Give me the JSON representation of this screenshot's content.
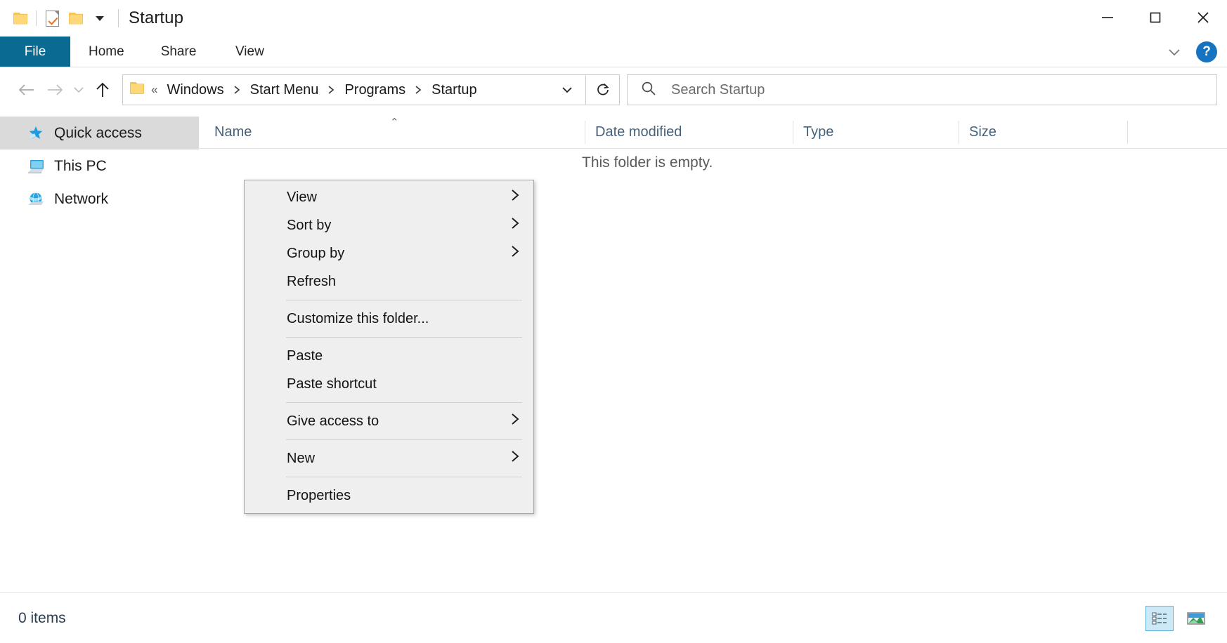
{
  "window": {
    "title": "Startup",
    "controls": {
      "minimize": "minimize-icon",
      "maximize": "maximize-icon",
      "close": "close-icon"
    },
    "quick_access_toolbar": {
      "folder_icon": "folder-icon",
      "properties_icon": "document-checkmark-icon",
      "new_folder_icon": "folder-icon",
      "customize_caret": "caret-down-icon"
    }
  },
  "ribbon": {
    "tabs": [
      {
        "label": "File",
        "active": true
      },
      {
        "label": "Home",
        "active": false
      },
      {
        "label": "Share",
        "active": false
      },
      {
        "label": "View",
        "active": false
      }
    ],
    "expand_icon": "chevron-down-icon",
    "help_label": "?",
    "file_tab_color": "#0b6a91"
  },
  "address": {
    "back_icon": "arrow-left-icon",
    "forward_icon": "arrow-right-icon",
    "recent_icon": "chevron-down-icon",
    "up_icon": "arrow-up-icon",
    "folder_icon": "folder-icon",
    "overflow": "«",
    "breadcrumbs": [
      "Windows",
      "Start Menu",
      "Programs",
      "Startup"
    ],
    "separator": "❯",
    "dropdown_icon": "chevron-down-icon",
    "refresh_icon": "refresh-icon"
  },
  "search": {
    "icon": "search-icon",
    "placeholder": "Search Startup",
    "value": ""
  },
  "sidebar": {
    "items": [
      {
        "label": "Quick access",
        "icon": "star-pin-icon",
        "selected": true
      },
      {
        "label": "This PC",
        "icon": "computer-icon",
        "selected": false
      },
      {
        "label": "Network",
        "icon": "network-globe-icon",
        "selected": false
      }
    ]
  },
  "file_list": {
    "columns": [
      {
        "label": "Name",
        "sorted": true,
        "sort_direction": "ascending"
      },
      {
        "label": "Date modified",
        "sorted": false
      },
      {
        "label": "Type",
        "sorted": false
      },
      {
        "label": "Size",
        "sorted": false
      }
    ],
    "sort_indicator": "⌃",
    "empty_message": "This folder is empty.",
    "rows": []
  },
  "context_menu": {
    "items": [
      {
        "label": "View",
        "submenu": true
      },
      {
        "label": "Sort by",
        "submenu": true
      },
      {
        "label": "Group by",
        "submenu": true
      },
      {
        "label": "Refresh",
        "submenu": false
      },
      {
        "separator": true
      },
      {
        "label": "Customize this folder...",
        "submenu": false
      },
      {
        "separator": true
      },
      {
        "label": "Paste",
        "submenu": false
      },
      {
        "label": "Paste shortcut",
        "submenu": false
      },
      {
        "separator": true
      },
      {
        "label": "Give access to",
        "submenu": true
      },
      {
        "separator": true
      },
      {
        "label": "New",
        "submenu": true
      },
      {
        "separator": true
      },
      {
        "label": "Properties",
        "submenu": false
      }
    ],
    "submenu_arrow": "❯",
    "background_color": "#efefef"
  },
  "statusbar": {
    "item_count": "0 items",
    "view_buttons": [
      {
        "name": "details-view",
        "active": true
      },
      {
        "name": "large-icons-view",
        "active": false
      }
    ]
  }
}
